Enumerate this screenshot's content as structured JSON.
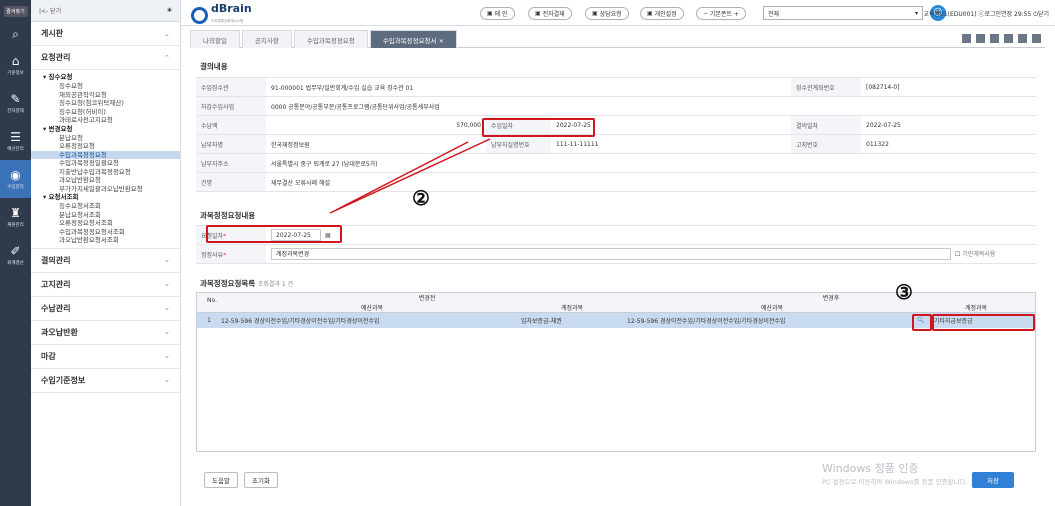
{
  "rail": {
    "favorites": "즐겨찾기",
    "items": [
      {
        "label": "기준정보",
        "icon": "home-icon"
      },
      {
        "label": "전자결재",
        "icon": "approval-icon"
      },
      {
        "label": "예산관리",
        "icon": "budget-icon"
      },
      {
        "label": "수입관리",
        "icon": "revenue-icon"
      },
      {
        "label": "재원관리",
        "icon": "fund-icon"
      },
      {
        "label": "회계결산",
        "icon": "settlement-icon"
      }
    ]
  },
  "sidebar": {
    "close": "|<- 닫기",
    "board": "게시판",
    "request": "요청관리",
    "tree": [
      {
        "group": "▾ 징수요청",
        "leaves": [
          "징수요청",
          "재외공관착각요청",
          "징수요청(첨코위탁재산)",
          "징수요청(허비이)",
          "과태료사전고지요청"
        ]
      },
      {
        "group": "▾ 변경요청",
        "leaves": [
          "분납요청",
          "오류정정요청",
          "수입과목정정요청",
          "수입과목정정일괄요청",
          "지출반납수입과목정정요청",
          "과오납반환요청",
          "부가가치세일괄과오납반환요청"
        ]
      },
      {
        "group": "▾ 요청서조회",
        "leaves": [
          "징수요청서조회",
          "분납요청서조회",
          "오류정정요청서조회",
          "수입과목정정요청서조회",
          "과오납반환요청서조회"
        ]
      }
    ],
    "selected_leaf": "수입과목정정요청",
    "sections": [
      "결의관리",
      "고지관리",
      "수납관리",
      "과오납반환",
      "마감",
      "수입기준정보"
    ]
  },
  "topbar": {
    "logo": "dBrain",
    "logo_sub": "디지털예산회계시스템",
    "pills": [
      "메 인",
      "전자결재",
      "상담요청",
      "개인설정",
      "기본폰트 +"
    ],
    "select": "전체",
    "user": "교육용01(EDU001) ⓒ로그인연장 29:55 ⏻닫기"
  },
  "tabs": [
    "나의할일",
    "공지사항",
    "수입과목정정요청",
    "수입과목정정요청서 ×"
  ],
  "resolution": {
    "title": "결의내용",
    "rows": [
      [
        {
          "l": "수입징수관"
        },
        {
          "v": "91-000001 법무부/일반회계/수입 실습 교육 징수관 01"
        },
        {
          "l": "징수관계좌번호"
        },
        {
          "v": "[082714-0]"
        }
      ],
      [
        {
          "l": "자감수입사업"
        },
        {
          "v": "0000 공통분야/공통부문/공통프로그램/공통단위사업/공통세부사업"
        }
      ],
      [
        {
          "l": "수납액"
        },
        {
          "v": "570,000"
        },
        {
          "l": "수입일자"
        },
        {
          "v": "2022-07-25"
        },
        {
          "l": "결의일자"
        },
        {
          "v": "2022-07-25"
        }
      ],
      [
        {
          "l": "납부자명"
        },
        {
          "v": "한국재정정보원"
        },
        {
          "l": "납부자실명번호"
        },
        {
          "v": "111-11-11111"
        },
        {
          "l": "고지번호"
        },
        {
          "v": "011322"
        }
      ],
      [
        {
          "l": "납부자주소"
        },
        {
          "v": "서울특별시 중구 퇴계로 27 (남대문로5가)"
        }
      ],
      [
        {
          "l": "건명"
        },
        {
          "v": "재무결산 오류사례 해설"
        }
      ]
    ]
  },
  "correction": {
    "title": "과목정정요청내용",
    "date_label": "요청일자",
    "date_value": "2022-07-25",
    "reason_label": "정정사유",
    "reason_value": "계정과목변경",
    "checkbox": "기안계목사용"
  },
  "list": {
    "title": "과목정정요청목록",
    "count": "조회결과 1 건",
    "headers": {
      "no": "No.",
      "before": "변경전",
      "after": "변경후",
      "budget": "예산과목",
      "account": "계정과목"
    },
    "row": {
      "no": "1",
      "before_budget": "12-59-596 경상이전수입/기타경상이전수입/기타경상이전수입",
      "before_account": "임차보증금-채권",
      "after_budget": "12-59-596 경상이전수입/기타경상이전수입/기타경상이전수입",
      "after_account": "기타지급보증금"
    }
  },
  "buttons": {
    "help": "도움말",
    "reset": "초기화",
    "save": "저장"
  },
  "watermark": {
    "title": "Windows 정품 인증",
    "sub": "PC 설정으로 이동하여 Windows를 정품 인증합니다."
  },
  "annotations": {
    "two": "②",
    "three": "③"
  }
}
